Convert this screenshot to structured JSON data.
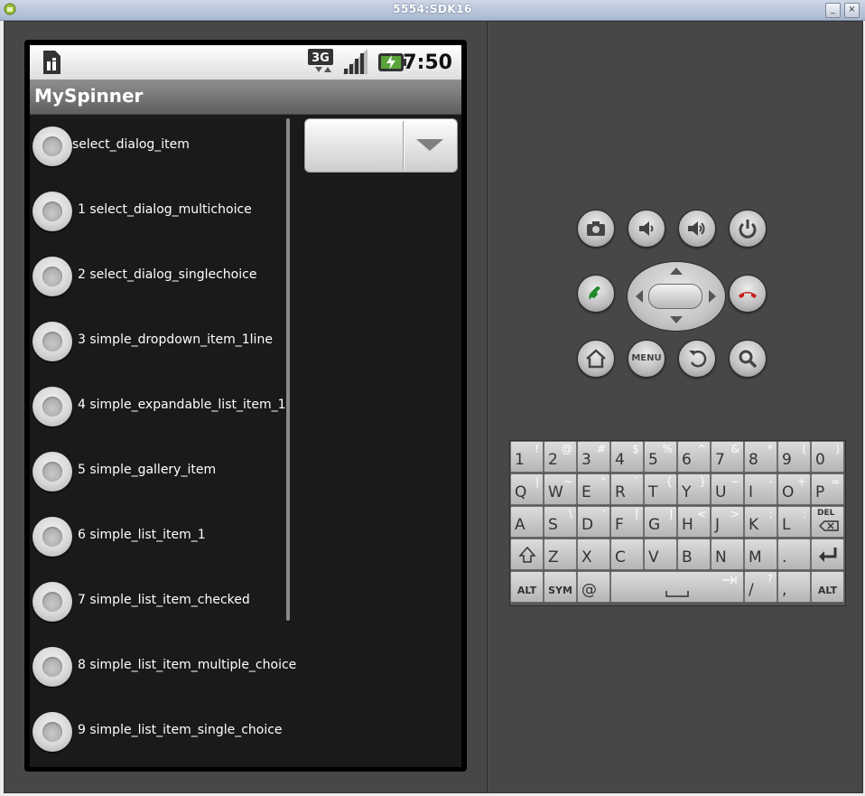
{
  "window": {
    "title": "5554:SDK16"
  },
  "status_bar": {
    "time": "7:50",
    "network": "3G",
    "icons": [
      "sim-card-icon",
      "3g-icon",
      "signal-icon",
      "battery-charging-icon"
    ]
  },
  "app": {
    "title": "MySpinner"
  },
  "list_items": [
    {
      "label": "select_dialog_item"
    },
    {
      "label": "1 select_dialog_multichoice"
    },
    {
      "label": "2 select_dialog_singlechoice"
    },
    {
      "label": "3 simple_dropdown_item_1line"
    },
    {
      "label": "4 simple_expandable_list_item_1"
    },
    {
      "label": "5 simple_gallery_item"
    },
    {
      "label": "6 simple_list_item_1"
    },
    {
      "label": "7 simple_list_item_checked"
    },
    {
      "label": "8 simple_list_item_multiple_choice"
    },
    {
      "label": "9 simple_list_item_single_choice"
    }
  ],
  "spinner": {
    "value": ""
  },
  "controls": {
    "menu_label": "MENU",
    "buttons": [
      "camera-icon",
      "volume-down-icon",
      "volume-up-icon",
      "power-icon",
      "call-icon",
      "end-call-icon",
      "home-icon",
      "menu",
      "back-icon",
      "search-icon"
    ]
  },
  "keyboard": {
    "row1": [
      [
        "1",
        "!"
      ],
      [
        "2",
        "@"
      ],
      [
        "3",
        "#"
      ],
      [
        "4",
        "$"
      ],
      [
        "5",
        "%"
      ],
      [
        "6",
        "^"
      ],
      [
        "7",
        "&"
      ],
      [
        "8",
        "*"
      ],
      [
        "9",
        "("
      ],
      [
        "0",
        ")"
      ]
    ],
    "row2": [
      [
        "Q",
        "|"
      ],
      [
        "W",
        "~"
      ],
      [
        "E",
        "\""
      ],
      [
        "R",
        "`"
      ],
      [
        "T",
        "{"
      ],
      [
        "Y",
        "}"
      ],
      [
        "U",
        "−"
      ],
      [
        "I",
        "-"
      ],
      [
        "O",
        "+"
      ],
      [
        "P",
        "="
      ]
    ],
    "row3": [
      [
        "A",
        ""
      ],
      [
        "S",
        "\\"
      ],
      [
        "D",
        "'"
      ],
      [
        "F",
        "["
      ],
      [
        "G",
        "]"
      ],
      [
        "H",
        "<"
      ],
      [
        "J",
        ">"
      ],
      [
        "K",
        ";"
      ],
      [
        "L",
        ":"
      ]
    ],
    "row3_del": "DEL",
    "row4": [
      [
        "Z",
        ""
      ],
      [
        "X",
        ""
      ],
      [
        "C",
        ""
      ],
      [
        "V",
        ""
      ],
      [
        "B",
        ""
      ],
      [
        "N",
        ""
      ],
      [
        "M",
        ""
      ],
      [
        ".",
        ""
      ]
    ],
    "row5": {
      "alt_left": "ALT",
      "sym": "SYM",
      "at": "@",
      "slash": "/",
      "slash_alt": "?",
      "comma": ",",
      "alt_right": "ALT"
    }
  }
}
